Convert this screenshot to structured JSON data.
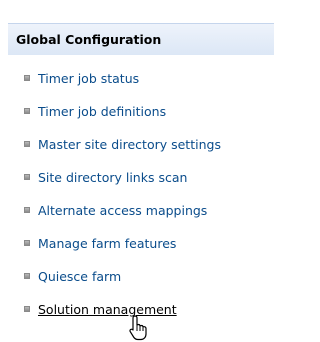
{
  "section": {
    "title": "Global Configuration",
    "links": [
      {
        "label": "Timer job status"
      },
      {
        "label": "Timer job definitions"
      },
      {
        "label": "Master site directory settings"
      },
      {
        "label": "Site directory links scan"
      },
      {
        "label": "Alternate access mappings"
      },
      {
        "label": "Manage farm features"
      },
      {
        "label": "Quiesce farm"
      },
      {
        "label": "Solution management"
      }
    ]
  },
  "icons": {
    "bullet": "square-bullet-icon",
    "cursor": "hand-pointer-icon"
  }
}
